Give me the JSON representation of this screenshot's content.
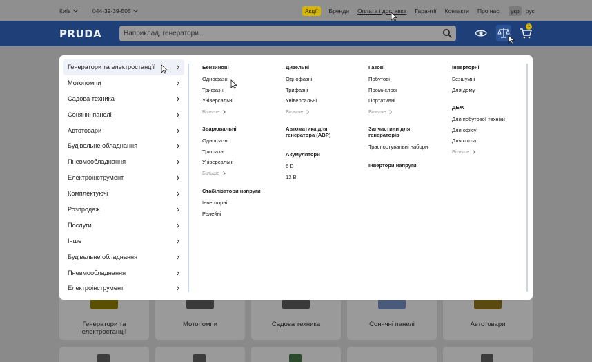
{
  "topbar": {
    "city": "Київ",
    "phone": "044-39-39-505",
    "nav": [
      "Акції",
      "Бренди",
      "Оплата і доставка",
      "Гарантії",
      "Контакти",
      "Про нас"
    ],
    "langs": [
      "укр",
      "рус"
    ]
  },
  "header": {
    "logo": "PRUDA",
    "search_placeholder": "Наприклад, генератори...",
    "cart_count": "1"
  },
  "menu": {
    "categories": [
      "Генератори та електростанції",
      "Мотопомпи",
      "Садова техника",
      "Сонячні панелі",
      "Автотовари",
      "Будівельне обладнання",
      "Пневмообладнання",
      "Електроінструмент",
      "Комплектуючі",
      "Розпродаж",
      "Послуги",
      "Інше",
      "Будівельне обладнання",
      "Пневмообладнання",
      "Електроінструмент"
    ],
    "more_label": "Більше",
    "groups": {
      "benz": {
        "title": "Бензинові",
        "items": [
          "Однофазні",
          "Трифазні",
          "Універсальні"
        ]
      },
      "weld": {
        "title": "Зварювальні",
        "items": [
          "Однофазні",
          "Трифазні",
          "Універсальні"
        ]
      },
      "stab": {
        "title": "Стабілізатори напруги",
        "items": [
          "Інверторні",
          "Релейні"
        ]
      },
      "diesel": {
        "title": "Дизельні",
        "items": [
          "Однофазні",
          "Трифазні",
          "Універсальні"
        ]
      },
      "avr": {
        "title": "Автоматика для генератора (АВР)",
        "items": []
      },
      "akum": {
        "title": "Акумулятори",
        "items": [
          "6 В",
          "12 В"
        ]
      },
      "gas": {
        "title": "Газові",
        "items": [
          "Побутові",
          "Промислові",
          "Портативні"
        ]
      },
      "parts": {
        "title": "Запчастини для генераторів",
        "items": [
          "Траспортувальні набори"
        ]
      },
      "inv_volt": {
        "title": "Інвертори напруги",
        "items": []
      },
      "inverter": {
        "title": "Інверторні",
        "items": [
          "Безшумні",
          "Для дому"
        ]
      },
      "ups": {
        "title": "ДБЖ",
        "items": [
          "Для побутової техніки",
          "Для офісу",
          "Для котла"
        ]
      }
    }
  },
  "cards": [
    "Генератори та електростанції",
    "Мотопомпи",
    "Садова техника",
    "Сонячні панелі",
    "Автотовари"
  ]
}
